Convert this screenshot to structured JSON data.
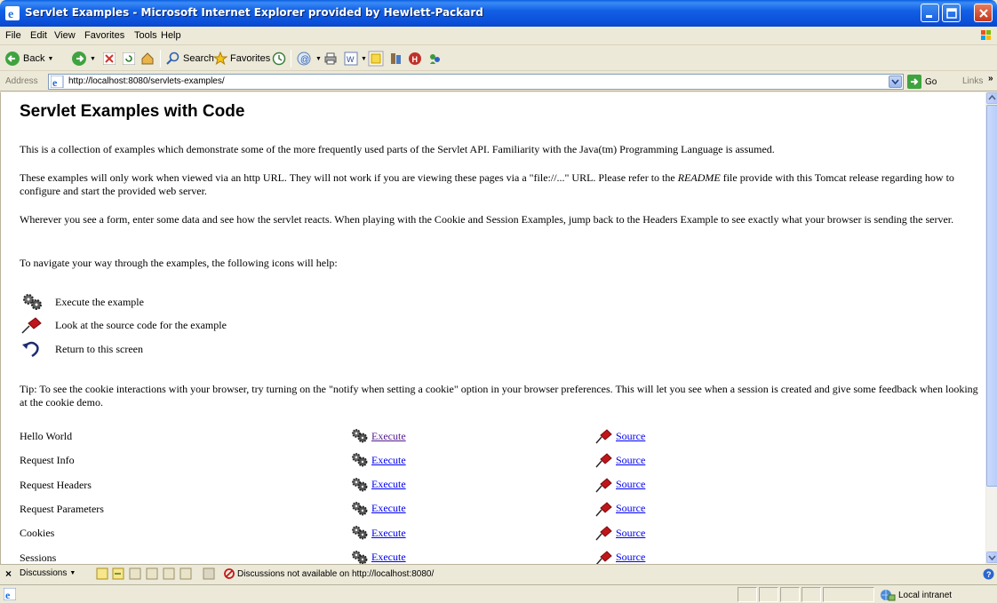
{
  "window": {
    "title": "Servlet Examples - Microsoft Internet Explorer provided by Hewlett-Packard"
  },
  "menu": {
    "items": [
      "File",
      "Edit",
      "View",
      "Favorites",
      "Tools",
      "Help"
    ]
  },
  "toolbar": {
    "back_label": "Back",
    "search_label": "Search",
    "favorites_label": "Favorites"
  },
  "address": {
    "label": "Address",
    "url": "http://localhost:8080/servlets-examples/",
    "go_label": "Go",
    "links_label": "Links"
  },
  "page": {
    "heading": "Servlet Examples with Code",
    "intro": "This is a collection of examples which demonstrate some of the more frequently used parts of the Servlet API. Familiarity with the Java(tm) Programming Language is assumed.",
    "http_note_pre": "These examples will only work when viewed via an http URL. They will not work if you are viewing these pages via a \"file://...\" URL. Please refer to the ",
    "http_note_em": "README",
    "http_note_post": " file provide with this Tomcat release regarding how to configure and start the provided web server.",
    "form_note": "Wherever you see a form, enter some data and see how the servlet reacts. When playing with the Cookie and Session Examples, jump back to the Headers Example to see exactly what your browser is sending the server.",
    "nav_note": "To navigate your way through the examples, the following icons will help:",
    "legend": [
      {
        "icon": "gears-icon",
        "text": "Execute the example"
      },
      {
        "icon": "pushpin-icon",
        "text": "Look at the source code for the example"
      },
      {
        "icon": "return-arrow-icon",
        "text": "Return to this screen"
      }
    ],
    "tip": "Tip: To see the cookie interactions with your browser, try turning on the \"notify when setting a cookie\" option in your browser preferences. This will let you see when a session is created and give some feedback when looking at the cookie demo.",
    "examples": [
      {
        "name": "Hello World",
        "execute": "Execute",
        "source": "Source",
        "execute_visited": true
      },
      {
        "name": "Request Info",
        "execute": "Execute",
        "source": "Source",
        "execute_visited": false
      },
      {
        "name": "Request Headers",
        "execute": "Execute",
        "source": "Source",
        "execute_visited": false
      },
      {
        "name": "Request Parameters",
        "execute": "Execute",
        "source": "Source",
        "execute_visited": false
      },
      {
        "name": "Cookies",
        "execute": "Execute",
        "source": "Source",
        "execute_visited": false
      },
      {
        "name": "Sessions",
        "execute": "Execute",
        "source": "Source",
        "execute_visited": false
      }
    ]
  },
  "discussion_bar": {
    "label": "Discussions",
    "status": "Discussions not available on http://localhost:8080/"
  },
  "statusbar": {
    "zone": "Local intranet"
  },
  "colors": {
    "link": "#0000EE",
    "visited": "#551A8B",
    "titlebar": "#0A5FE0"
  }
}
